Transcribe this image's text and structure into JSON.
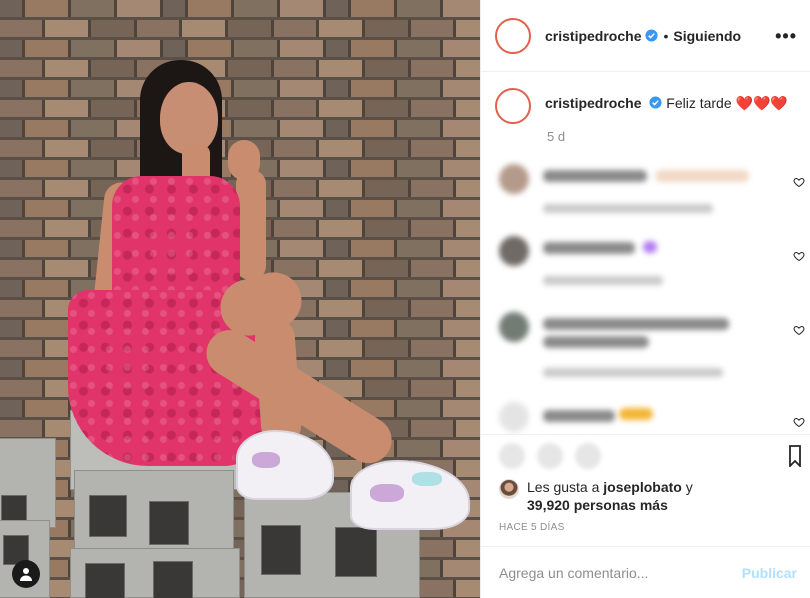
{
  "post": {
    "username": "cristipedroche",
    "following_label": "Siguiendo",
    "more_label": "•••",
    "caption_text": "Feliz tarde ❤️❤️❤️",
    "caption_age": "5 d"
  },
  "likes": {
    "prefix": "Les gusta a",
    "liker": "joseplobato",
    "connector": "y",
    "others": "39,920 personas más"
  },
  "timestamp": "HACE 5 DÍAS",
  "comment_box": {
    "placeholder": "Agrega un comentario...",
    "publish_label": "Publicar"
  },
  "colors": {
    "verified": "#3897f0",
    "publish_disabled": "#b2dffc",
    "avatar_ring": "#e0614d",
    "dress": "#e0346a"
  }
}
